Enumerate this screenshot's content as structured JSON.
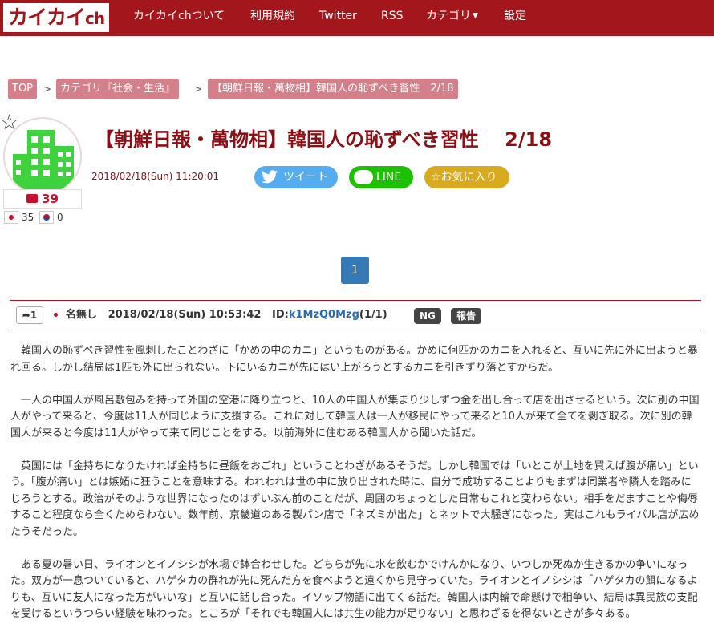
{
  "header": {
    "logo_main": "カイカイ",
    "logo_ch": "ch",
    "nav": [
      "カイカイchついて",
      "利用規約",
      "Twitter",
      "RSS",
      "カテゴリ",
      "設定"
    ]
  },
  "breadcrumb": {
    "top": "TOP",
    "category": "カテゴリ『社会・生活』",
    "current": "【朝鮮日報・萬物相】韓国人の恥ずべき習性　2/18",
    "separator": ">"
  },
  "article": {
    "title": "【朝鮮日報・萬物相】韓国人の恥ずべき習性　 2/18",
    "date": "2018/02/18(Sun) 11:20:01",
    "comment_count": "39",
    "jp_count": "35",
    "kr_count": "0",
    "tweet_label": "ツイート",
    "line_label": "LINE",
    "fav_label": "☆お気に入り"
  },
  "pagination": {
    "current": "1"
  },
  "post": {
    "res_count": "1",
    "name": "名無し",
    "datetime": "2018/02/18(Sun) 10:53:42",
    "id_label": "ID:",
    "id_value": "k1MzQ0Mzg",
    "id_suffix": "(1/1)",
    "ng_label": "NG",
    "report_label": "報告",
    "paragraphs": [
      "韓国人の恥ずべき習性を風刺したことわざに「かめの中のカニ」というものがある。かめに何匹かのカニを入れると、互いに先に外に出ようと暴れ回る。しかし結局は1匹も外に出られない。下にいるカニが先にはい上がろうとするカニを引きずり落とすからだ。",
      "一人の中国人が風呂敷包みを持って外国の空港に降り立つと、10人の中国人が集まり少しずつ金を出し合って店を出させるという。次に別の中国人がやって来ると、今度は11人が同じように支援する。これに対して韓国人は一人が移民にやって来ると10人が来て全てを剥ぎ取る。次に別の韓国人が来ると今度は11人がやって来て同じことをする。以前海外に住むある韓国人から聞いた話だ。",
      "英国には「金持ちになりたければ金持ちに昼飯をおごれ」ということわざがあるそうだ。しかし韓国では「いとこが土地を買えば腹が痛い」という。「腹が痛い」とは嫉妬に狂うことを意味する。われわれは世の中に放り出された時に、自分で成功することよりもまずは同業者や隣人を踏みにじろうとする。政治がそのような世界になったのはずいぶん前のことだが、周囲のちょっとした日常もこれと変わらない。相手をだますことや侮辱すること程度なら全くためらわない。数年前、京畿道のある製パン店で「ネズミが出た」とネットで大騒ぎになった。実はこれもライバル店が広めたうそだった。",
      "ある夏の暑い日、ライオンとイノシシが水場で鉢合わせした。どちらが先に水を飲むかでけんかになり、いつしか死ぬか生きるかの争いになった。双方が一息ついていると、ハゲタカの群れが先に死んだ方を食べようと遠くから見守っていた。ライオンとイノシシは「ハゲタカの餌になるよりも、互いに友人になった方がいいな」と互いに話し合った。イソップ物語に出てくる話だ。韓国人は内輪で命懸けで相争い、結局は異民族の支配を受けるというつらい経験を味わった。ところが「それでも韓国人には共生の能力が足りない」と思わざるを得ないときが多々ある。"
    ]
  },
  "colors": {
    "brand": "#a3161c",
    "breadcrumb": "#d4808a",
    "title": "#8b0f14",
    "twitter": "#55acee",
    "line": "#1cc100",
    "favorite": "#d8aa1e",
    "page": "#337ab7"
  },
  "icons": [
    "star-outline-icon",
    "building-icon",
    "comment-icon",
    "japan-flag-icon",
    "korea-flag-icon",
    "twitter-bird-icon",
    "line-icon",
    "reply-arrow-icon"
  ]
}
